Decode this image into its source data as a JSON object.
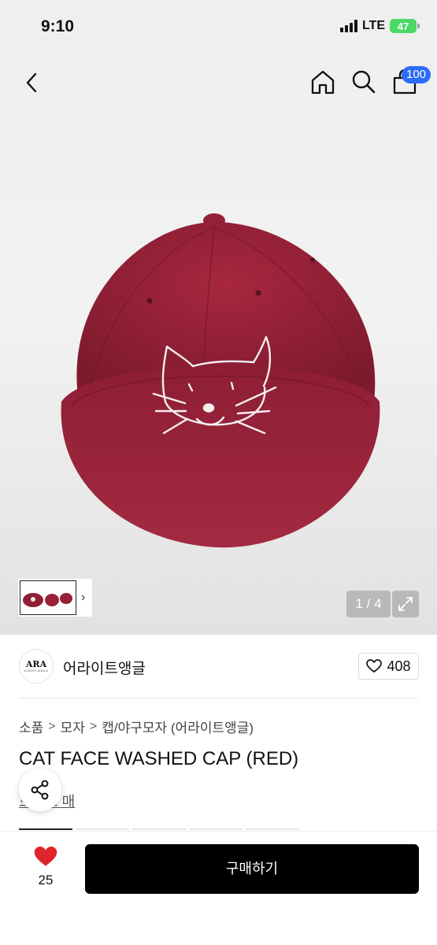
{
  "status_bar": {
    "time": "9:10",
    "network": "LTE",
    "battery": "47"
  },
  "header": {
    "back_icon": "chevron-left-icon",
    "home_icon": "home-icon",
    "search_icon": "search-icon",
    "cart_icon": "shopping-bag-icon",
    "cart_badge": "100"
  },
  "gallery": {
    "counter": "1 / 4",
    "thumb_arrow": "›",
    "expand_icon": "expand-icon",
    "cap_color": "#9a1f36"
  },
  "brand": {
    "logo_text": "ARA",
    "logo_small": "A RIGHT ANGLE",
    "name": "어라이트앵글",
    "like_count": "408"
  },
  "breadcrumb": [
    "소품",
    "모자",
    "캡/야구모자 (어라이트앵글)"
  ],
  "product": {
    "title": "CAT FACE WASHED CAP (RED)",
    "partial_link": "브랜드 매"
  },
  "bottom_bar": {
    "heart_count": "25",
    "buy_label": "구매하기",
    "heart_color": "#e0242c"
  },
  "colors": {
    "accent_blue": "#2d6cf6",
    "buy_button": "#000000"
  }
}
